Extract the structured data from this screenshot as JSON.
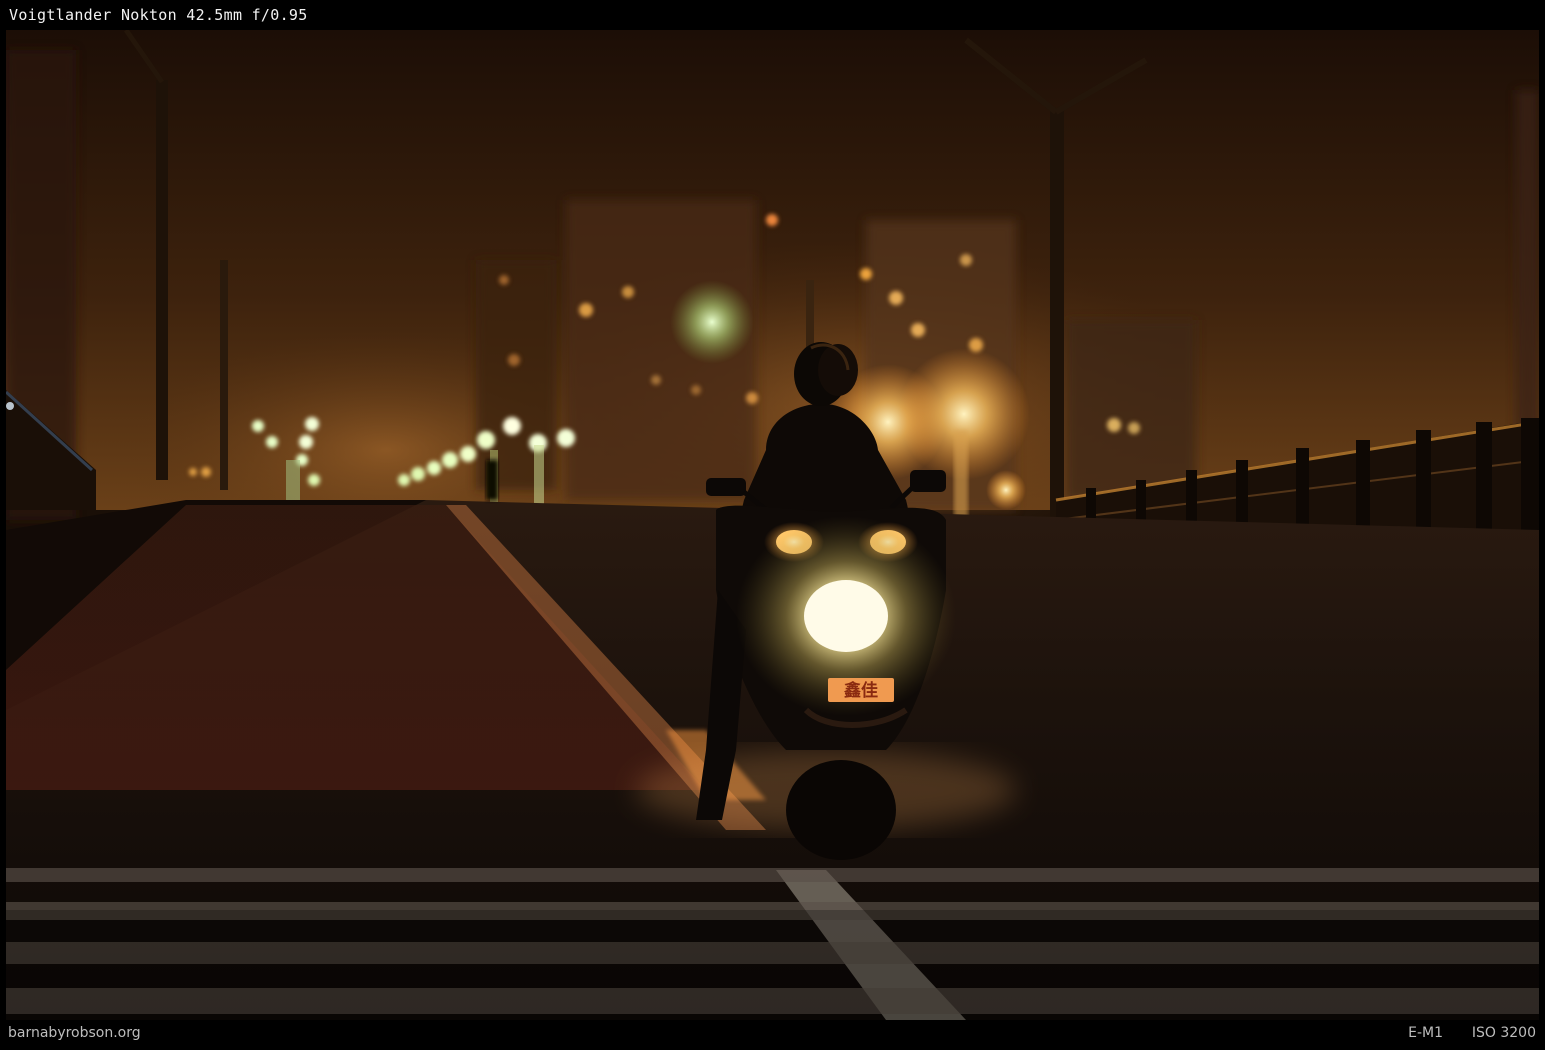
{
  "header": {
    "lens_label": "Voigtlander Nokton 42.5mm f/0.95"
  },
  "photo": {
    "plate_text": "鑫佳",
    "colors": {
      "sky_top": "#1c0e06",
      "sky_horizon": "#5a3414",
      "road": "#140c07",
      "headlight": "#fff6c8",
      "lamp": "#ffc860",
      "lamp_green": "#d8ffb0"
    }
  },
  "footer": {
    "site": "barnabyrobson.org",
    "camera": "E-M1",
    "iso": "ISO 3200"
  }
}
